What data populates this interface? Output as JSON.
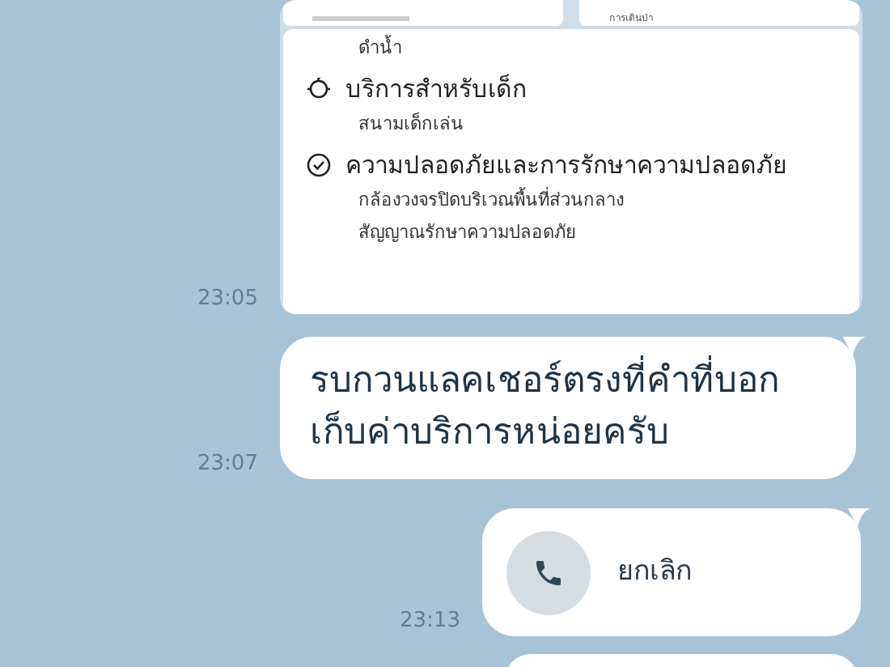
{
  "messages": [
    {
      "kind": "image",
      "time": "23:05",
      "top_cards": [
        {
          "kind": "blank"
        },
        {
          "kind": "caption",
          "caption": "การเดินป่า"
        }
      ],
      "lines": [
        {
          "kind": "item",
          "text": "ดำน้ำ"
        },
        {
          "kind": "heading",
          "text": "บริการสำหรับเด็ก"
        },
        {
          "kind": "item",
          "text": "สนามเด็กเล่น"
        },
        {
          "kind": "heading",
          "text": "ความปลอดภัยและการรักษาความปลอดภัย"
        },
        {
          "kind": "item",
          "text": "กล้องวงจรปิดบริเวณพื้นที่ส่วนกลาง"
        },
        {
          "kind": "item",
          "text": "สัญญาณรักษาความปลอดภัย"
        }
      ]
    },
    {
      "kind": "text",
      "time": "23:07",
      "text": "รบกวนแลคเชอร์ตรงที่คำที่บอกเก็บค่าบริการหน่อยครับ"
    },
    {
      "kind": "call",
      "time": "23:13",
      "text": "ยกเลิก"
    }
  ]
}
